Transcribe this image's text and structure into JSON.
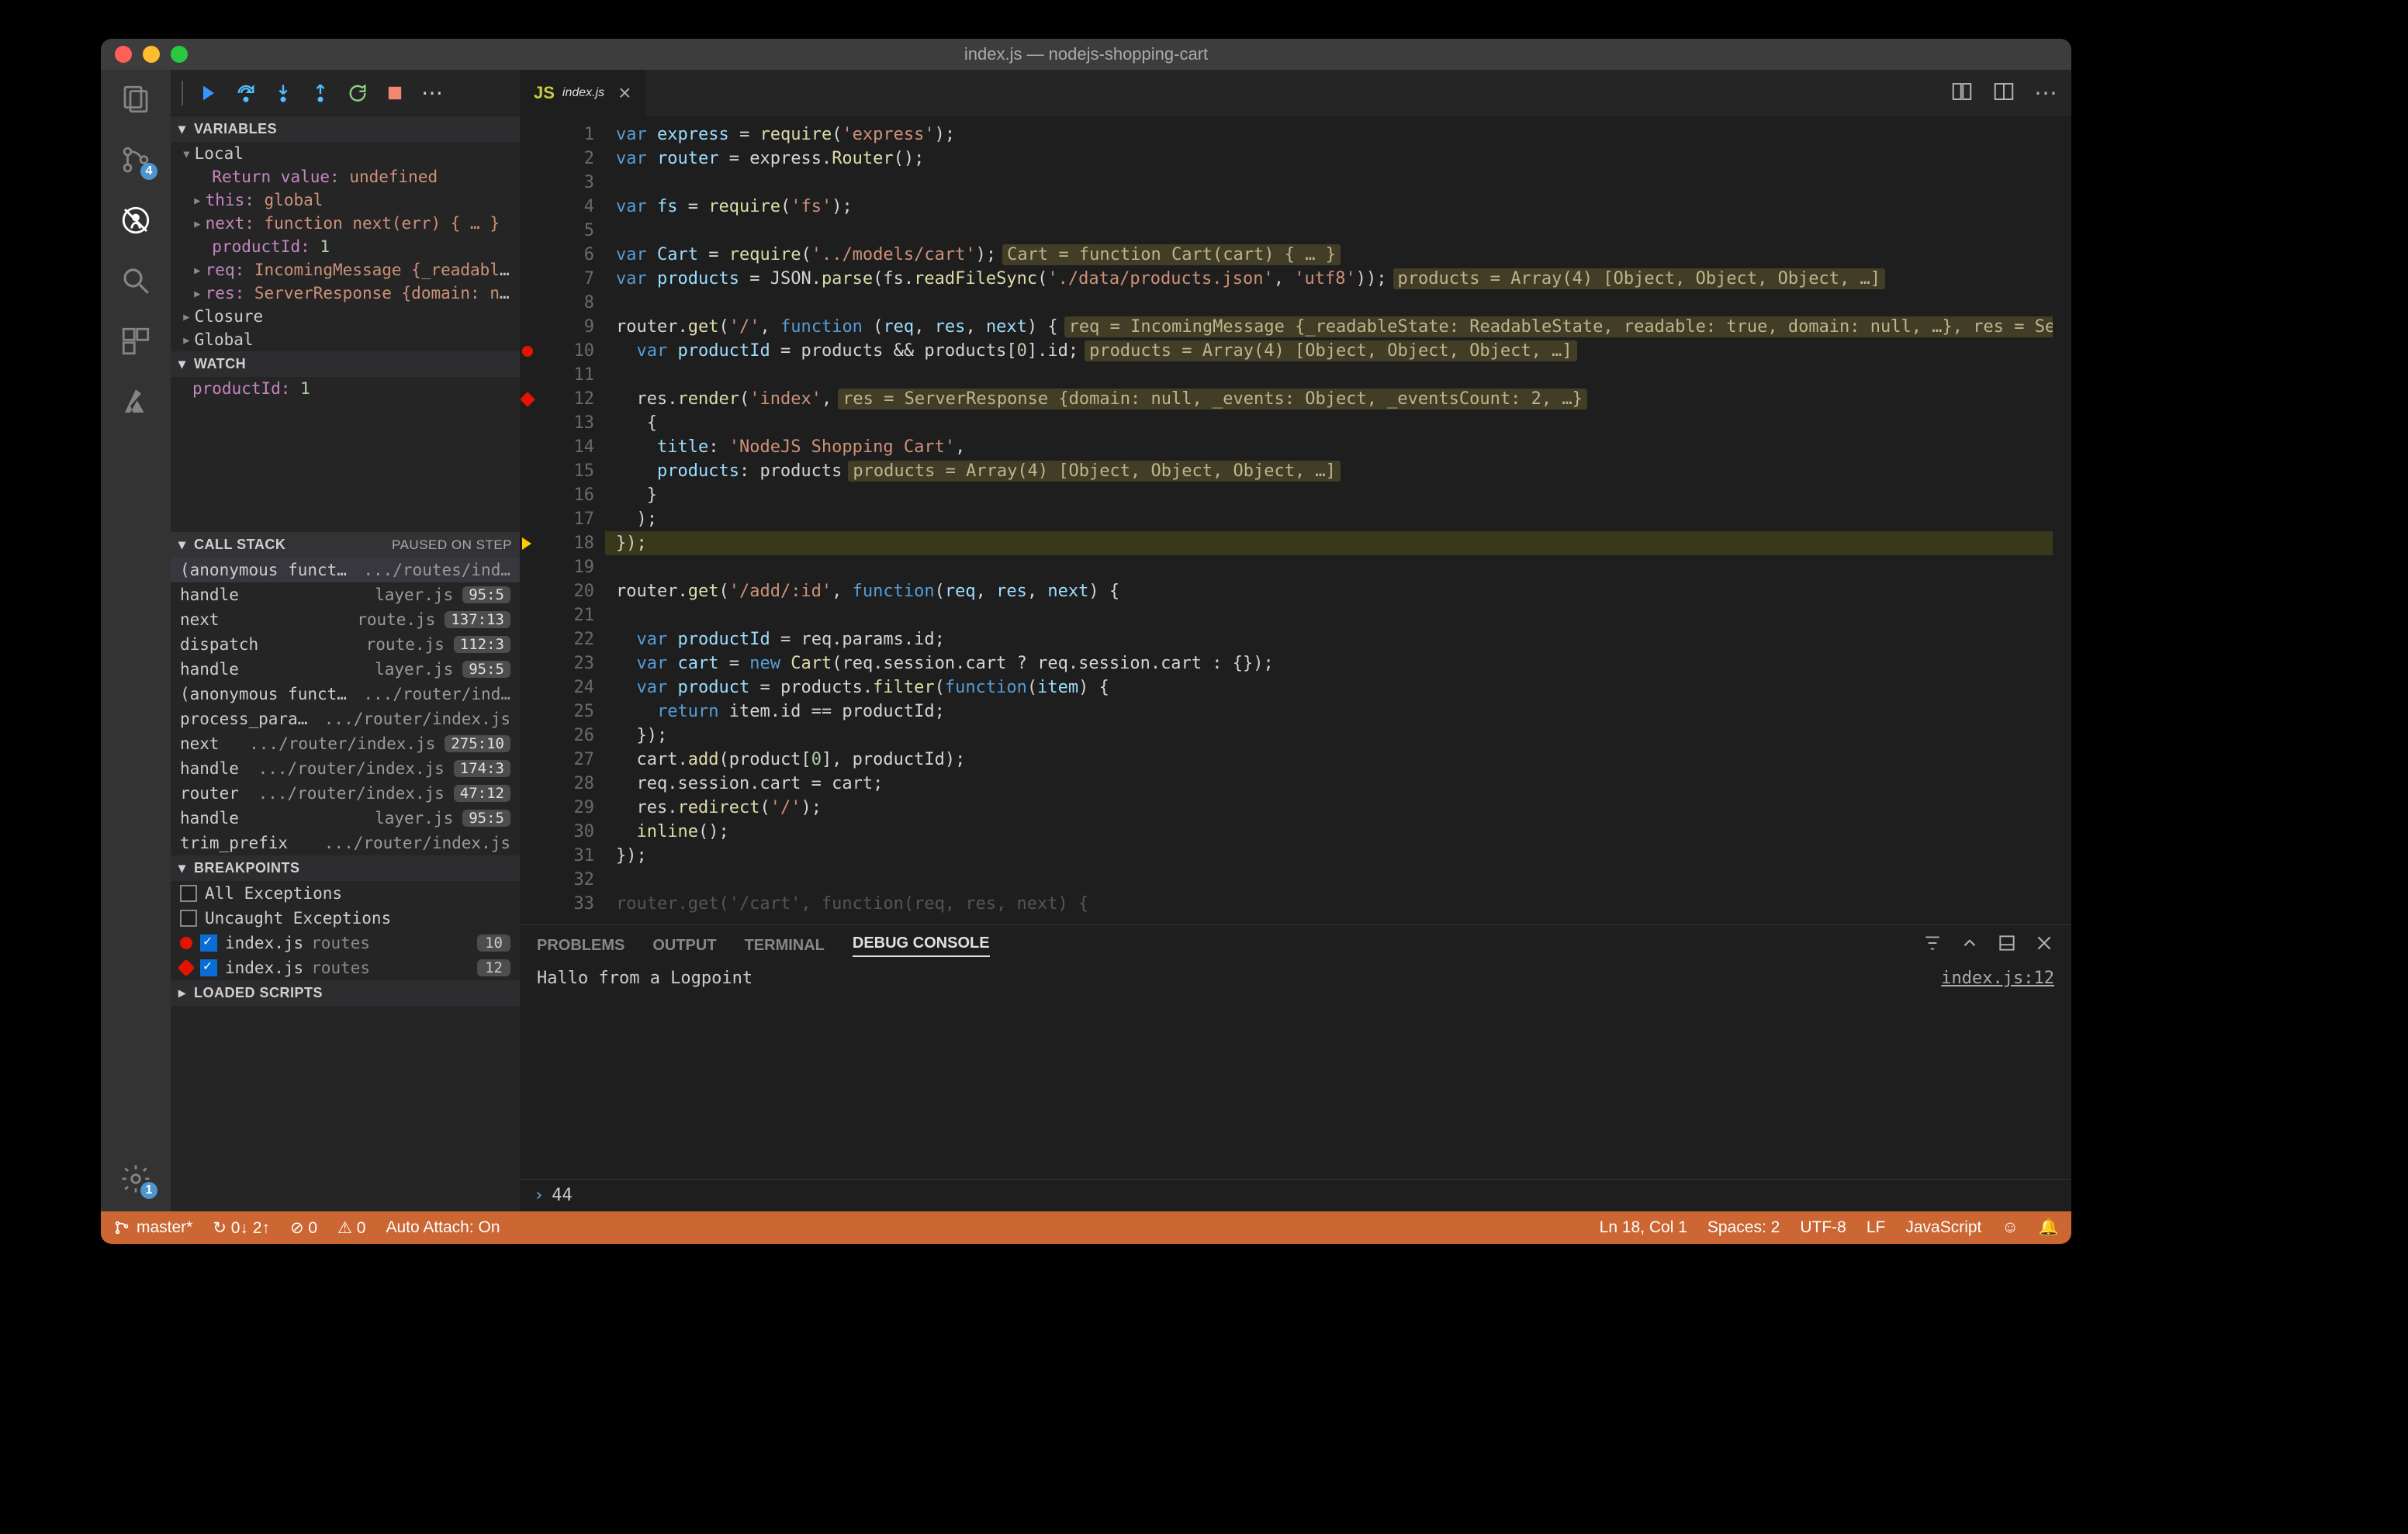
{
  "window_title": "index.js — nodejs-shopping-cart",
  "activity_badges": {
    "scm": "4",
    "settings": "1"
  },
  "debug_sections": {
    "variables": "VARIABLES",
    "watch": "WATCH",
    "callstack": "CALL STACK",
    "callstack_note": "PAUSED ON STEP",
    "breakpoints": "BREAKPOINTS",
    "loaded_scripts": "LOADED SCRIPTS"
  },
  "variables": {
    "scope_local": "Local",
    "rows": [
      {
        "k": "Return value:",
        "v": "undefined",
        "hasChild": false
      },
      {
        "k": "this:",
        "v": "global",
        "hasChild": true
      },
      {
        "k": "next:",
        "v": "function next(err) { … }",
        "hasChild": true
      },
      {
        "k": "productId:",
        "v": "1",
        "num": true,
        "hasChild": false
      },
      {
        "k": "req:",
        "v": "IncomingMessage {_readableSt…",
        "hasChild": true
      },
      {
        "k": "res:",
        "v": "ServerResponse {domain: null…",
        "hasChild": true
      }
    ],
    "scope_closure": "Closure",
    "scope_global": "Global"
  },
  "watch_rows": [
    {
      "k": "productId:",
      "v": "1"
    }
  ],
  "callstack": [
    {
      "fn": "(anonymous function)",
      "file": ".../routes/ind…",
      "lc": "",
      "sel": true
    },
    {
      "fn": "handle",
      "file": "layer.js",
      "lc": "95:5"
    },
    {
      "fn": "next",
      "file": "route.js",
      "lc": "137:13"
    },
    {
      "fn": "dispatch",
      "file": "route.js",
      "lc": "112:3"
    },
    {
      "fn": "handle",
      "file": "layer.js",
      "lc": "95:5"
    },
    {
      "fn": "(anonymous function)",
      "file": ".../router/ind…",
      "lc": ""
    },
    {
      "fn": "process_params",
      "file": ".../router/index.js",
      "lc": ""
    },
    {
      "fn": "next",
      "file": ".../router/index.js",
      "lc": "275:10"
    },
    {
      "fn": "handle",
      "file": ".../router/index.js",
      "lc": "174:3"
    },
    {
      "fn": "router",
      "file": ".../router/index.js",
      "lc": "47:12"
    },
    {
      "fn": "handle",
      "file": "layer.js",
      "lc": "95:5"
    },
    {
      "fn": "trim_prefix",
      "file": ".../router/index.js",
      "lc": ""
    }
  ],
  "breakpoints": {
    "all_exc": "All Exceptions",
    "uncaught": "Uncaught Exceptions",
    "items": [
      {
        "file": "index.js",
        "dir": "routes",
        "line": "10",
        "kind": "bp"
      },
      {
        "file": "index.js",
        "dir": "routes",
        "line": "12",
        "kind": "lp"
      }
    ]
  },
  "tab": {
    "file": "index.js"
  },
  "code_lines": [
    {
      "n": 1,
      "html": "<span class='tok-kw'>var</span> <span class='tok-var'>express</span> = <span class='tok-fn'>require</span>(<span class='tok-str'>'express'</span>);"
    },
    {
      "n": 2,
      "html": "<span class='tok-kw'>var</span> <span class='tok-var'>router</span> = express.<span class='tok-fn'>Router</span>();"
    },
    {
      "n": 3,
      "html": ""
    },
    {
      "n": 4,
      "html": "<span class='tok-kw'>var</span> <span class='tok-var'>fs</span> = <span class='tok-fn'>require</span>(<span class='tok-str'>'fs'</span>);"
    },
    {
      "n": 5,
      "html": ""
    },
    {
      "n": 6,
      "html": "<span class='tok-kw'>var</span> <span class='tok-var'>Cart</span> = <span class='tok-fn'>require</span>(<span class='tok-str'>'../models/cart'</span>);<span class='tok-hint'>Cart = function Cart(cart) { … }</span>"
    },
    {
      "n": 7,
      "html": "<span class='tok-kw'>var</span> <span class='tok-var'>products</span> = JSON.<span class='tok-fn'>parse</span>(fs.<span class='tok-fn'>readFileSync</span>(<span class='tok-str'>'./data/products.json'</span>, <span class='tok-str'>'utf8'</span>));<span class='tok-hint'>products = Array(4) [Object, Object, Object, …]</span>"
    },
    {
      "n": 8,
      "html": ""
    },
    {
      "n": 9,
      "html": "router.<span class='tok-fn'>get</span>(<span class='tok-str'>'/'</span>, <span class='tok-kw'>function</span> (<span class='tok-var'>req</span>, <span class='tok-var'>res</span>, <span class='tok-var'>next</span>) {<span class='tok-hint'>req = IncomingMessage {_readableState: ReadableState, readable: true, domain: null, …}, res = ServerRes…</span>"
    },
    {
      "n": 10,
      "glyph": "bp",
      "html": "  <span class='tok-kw'>var</span> <span class='tok-var'>productId</span> = products && products[<span class='tok-num'>0</span>].id;<span class='tok-hint'>products = Array(4) [Object, Object, Object, …]</span>"
    },
    {
      "n": 11,
      "html": ""
    },
    {
      "n": 12,
      "glyph": "lp",
      "html": "  res.<span class='tok-fn'>render</span>(<span class='tok-str'>'index'</span>,<span class='tok-hint'>res = ServerResponse {domain: null, _events: Object, _eventsCount: 2, …}</span>"
    },
    {
      "n": 13,
      "html": "   {"
    },
    {
      "n": 14,
      "html": "    <span class='tok-var'>title</span>: <span class='tok-str'>'NodeJS Shopping Cart'</span>,"
    },
    {
      "n": 15,
      "html": "    <span class='tok-var'>products</span>: products<span class='tok-hint'>products = Array(4) [Object, Object, Object, …]</span>"
    },
    {
      "n": 16,
      "html": "   }"
    },
    {
      "n": 17,
      "html": "  );"
    },
    {
      "n": 18,
      "glyph": "cur",
      "current": true,
      "html": "});"
    },
    {
      "n": 19,
      "html": ""
    },
    {
      "n": 20,
      "html": "router.<span class='tok-fn'>get</span>(<span class='tok-str'>'/add/:id'</span>, <span class='tok-kw'>function</span>(<span class='tok-var'>req</span>, <span class='tok-var'>res</span>, <span class='tok-var'>next</span>) {"
    },
    {
      "n": 21,
      "html": ""
    },
    {
      "n": 22,
      "html": "  <span class='tok-kw'>var</span> <span class='tok-var'>productId</span> = req.params.id;"
    },
    {
      "n": 23,
      "html": "  <span class='tok-kw'>var</span> <span class='tok-var'>cart</span> = <span class='tok-kw'>new</span> <span class='tok-fn'>Cart</span>(req.session.cart ? req.session.cart : {});"
    },
    {
      "n": 24,
      "html": "  <span class='tok-kw'>var</span> <span class='tok-var'>product</span> = products.<span class='tok-fn'>filter</span>(<span class='tok-kw'>function</span>(<span class='tok-var'>item</span>) {"
    },
    {
      "n": 25,
      "html": "    <span class='tok-kw'>return</span> item.id == productId;"
    },
    {
      "n": 26,
      "html": "  });"
    },
    {
      "n": 27,
      "html": "  cart.<span class='tok-fn'>add</span>(product[<span class='tok-num'>0</span>], productId);"
    },
    {
      "n": 28,
      "html": "  req.session.cart = cart;"
    },
    {
      "n": 29,
      "html": "  res.<span class='tok-fn'>redirect</span>(<span class='tok-str'>'/'</span>);"
    },
    {
      "n": 30,
      "html": "  <span class='tok-fn'>inline</span>();"
    },
    {
      "n": 31,
      "html": "});"
    },
    {
      "n": 32,
      "html": ""
    },
    {
      "n": 33,
      "faded": true,
      "html": "router.get('/cart', function(req, res, next) {"
    }
  ],
  "panel": {
    "tabs": {
      "problems": "PROBLEMS",
      "output": "OUTPUT",
      "terminal": "TERMINAL",
      "debug_console": "DEBUG CONSOLE"
    },
    "msg": "Hallo from a Logpoint",
    "loc": "index.js:12"
  },
  "repl_value": "44",
  "status": {
    "branch": "master*",
    "sync": "↻ 0↓ 2↑",
    "errors": "⊘ 0",
    "warnings": "⚠ 0",
    "auto_attach": "Auto Attach: On",
    "pos": "Ln 18, Col 1",
    "spaces": "Spaces: 2",
    "enc": "UTF-8",
    "eol": "LF",
    "lang": "JavaScript"
  }
}
